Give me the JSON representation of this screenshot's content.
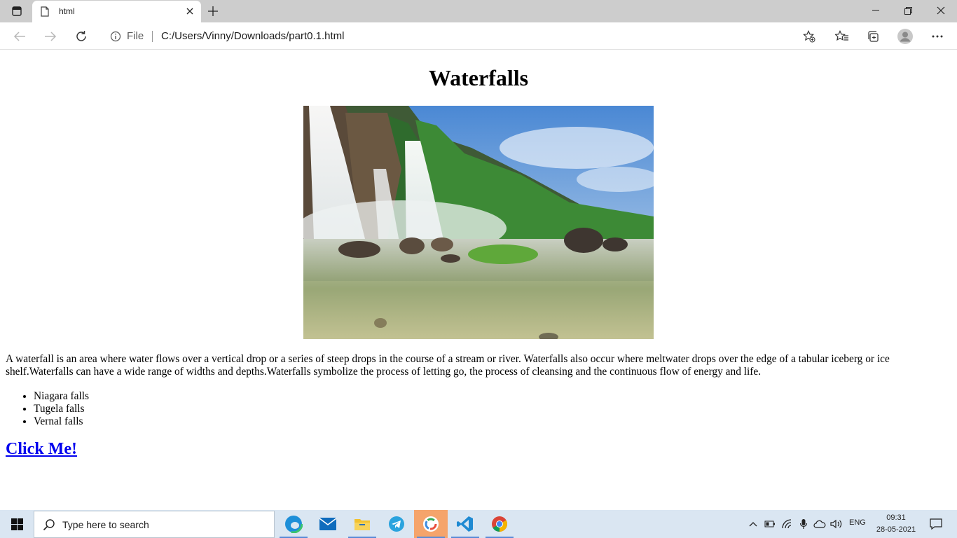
{
  "browser": {
    "tab_title": "html",
    "address": {
      "scheme": "File",
      "url": "C:/Users/Vinny/Downloads/part0.1.html"
    }
  },
  "page": {
    "heading": "Waterfalls",
    "image_alt": "Waterfall",
    "paragraph": "A waterfall is an area where water flows over a vertical drop or a series of steep drops in the course of a stream or river. Waterfalls also occur where meltwater drops over the edge of a tabular iceberg or ice shelf.Waterfalls can have a wide range of widths and depths.Waterfalls symbolize the process of letting go, the process of cleansing and the continuous flow of energy and life.",
    "list": [
      "Niagara falls",
      "Tugela falls",
      "Vernal falls"
    ],
    "link": "Click Me!"
  },
  "taskbar": {
    "search_placeholder": "Type here to search",
    "language": "ENG",
    "time": "09:31",
    "date": "28-05-2021"
  },
  "colors": {
    "link": "#0000ee",
    "taskbar": "#dae6f2",
    "tabstrip": "#cdcdcd"
  }
}
